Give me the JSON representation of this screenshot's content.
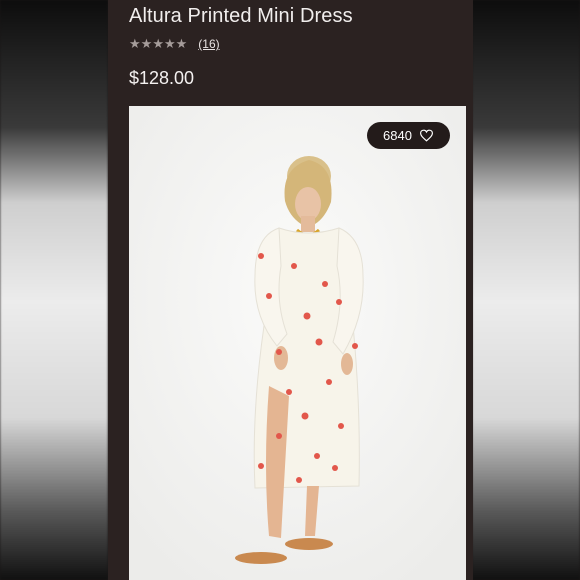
{
  "product": {
    "title": "Altura Printed Mini Dress",
    "rating_stars": 5,
    "reviews": "(16)",
    "price": "$128.00"
  },
  "image": {
    "likes": "6840"
  },
  "colors": {
    "panel": "#2b2221",
    "dots": "#e2574b"
  }
}
